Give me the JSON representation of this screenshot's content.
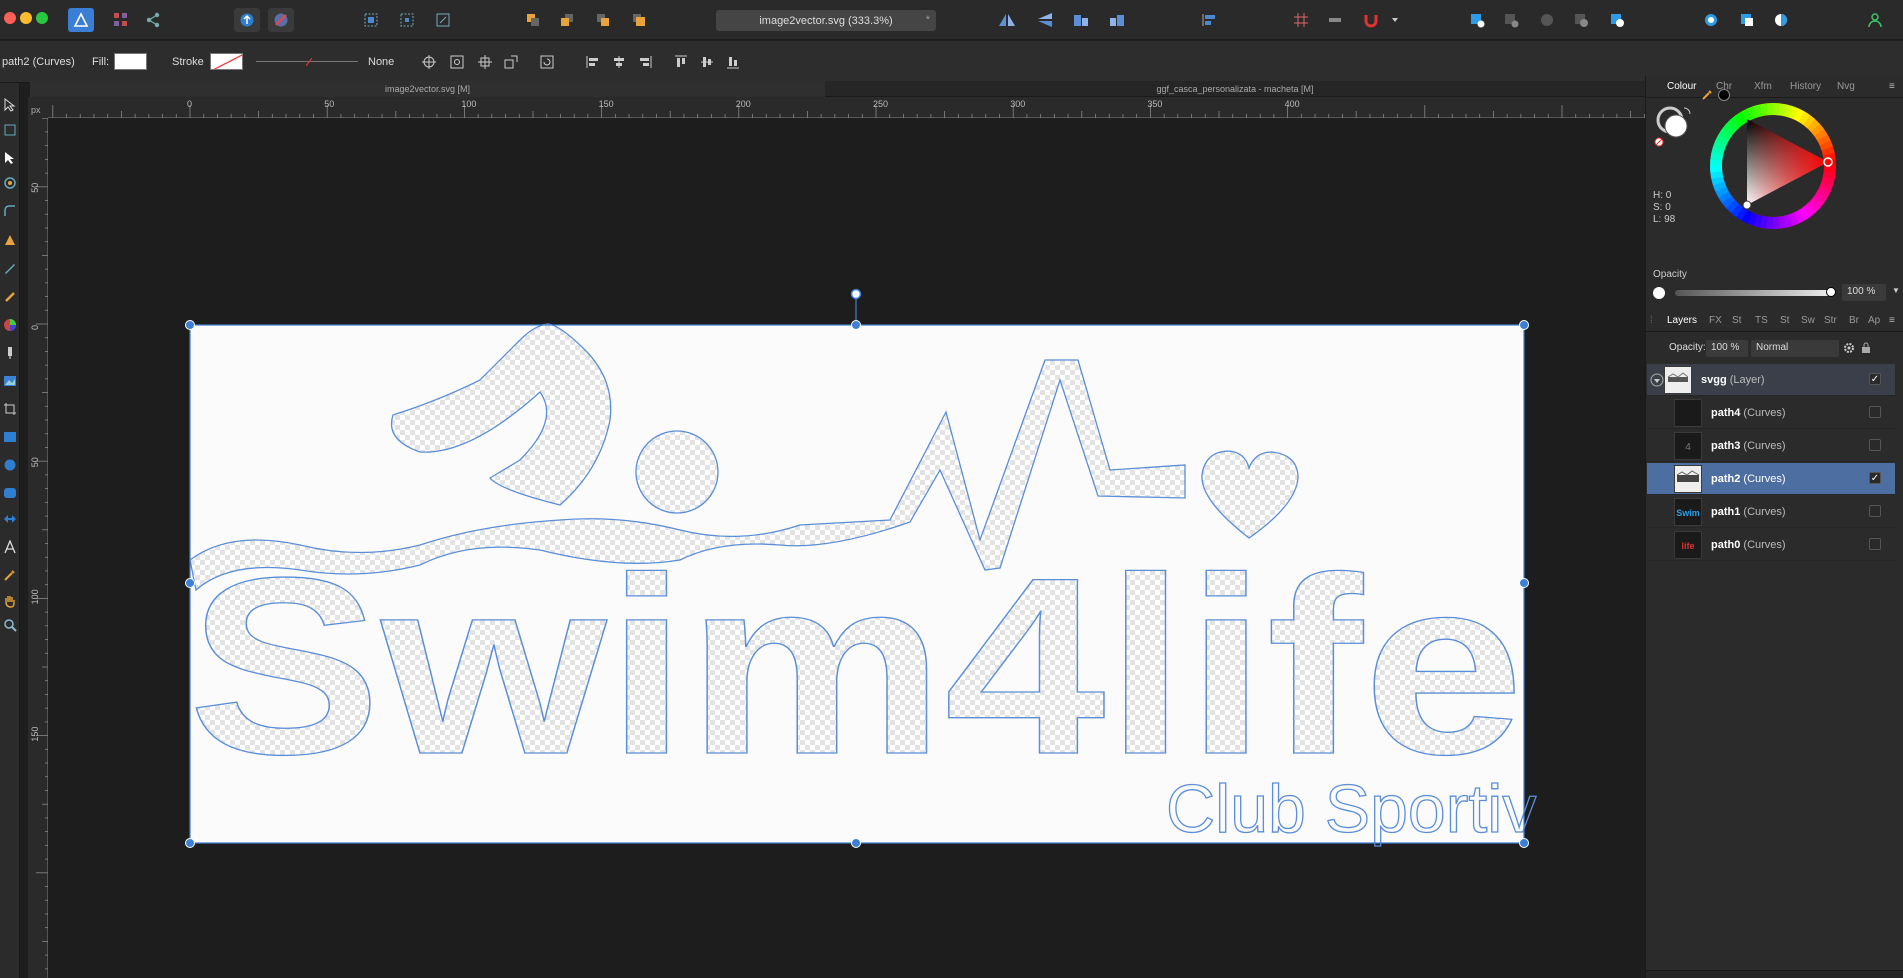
{
  "app": {
    "name": "Affinity Designer"
  },
  "toolbar": {
    "document_title": "image2vector.svg (333.3%)",
    "modified_marker": "*"
  },
  "context": {
    "selection": "path2 (Curves)",
    "fill_label": "Fill:",
    "stroke_label": "Stroke",
    "stroke_none": "None"
  },
  "doc_tabs": [
    "image2vector.svg [M]",
    "ggf_casca_personalizata - macheta [M]"
  ],
  "ruler": {
    "unit": "px",
    "h_ticks": [
      "0",
      "50",
      "100",
      "150",
      "200",
      "250",
      "300",
      "350",
      "400"
    ],
    "v_ticks": [
      "50",
      "0",
      "50",
      "100",
      "150"
    ]
  },
  "artwork": {
    "main_text": "Swim4life",
    "sub_text": "Club Sportiv"
  },
  "colour_panel": {
    "tabs": [
      "Colour",
      "Chr",
      "Xfm",
      "History",
      "Nvg"
    ],
    "active_tab": "Colour",
    "h": "H: 0",
    "s": "S: 0",
    "l": "L: 98",
    "opacity_label": "Opacity",
    "opacity_value": "100 %"
  },
  "layers_panel": {
    "tabs": [
      "Layers",
      "FX",
      "St",
      "TS",
      "St",
      "Sw",
      "Str",
      "Br",
      "Ap"
    ],
    "active_tab": "Layers",
    "opacity_label": "Opacity:",
    "opacity_value": "100 %",
    "blend_mode": "Normal",
    "layers": [
      {
        "name": "svgg",
        "kind": "(Layer)",
        "checked": true,
        "selected": false,
        "thumb_glyph": ""
      },
      {
        "name": "path4",
        "kind": "(Curves)",
        "checked": false,
        "selected": false,
        "thumb_glyph": ""
      },
      {
        "name": "path3",
        "kind": "(Curves)",
        "checked": false,
        "selected": false,
        "thumb_glyph": "4"
      },
      {
        "name": "path2",
        "kind": "(Curves)",
        "checked": true,
        "selected": true,
        "thumb_glyph": ""
      },
      {
        "name": "path1",
        "kind": "(Curves)",
        "checked": false,
        "selected": false,
        "thumb_glyph": "Swim"
      },
      {
        "name": "path0",
        "kind": "(Curves)",
        "checked": false,
        "selected": false,
        "thumb_glyph": "life"
      }
    ],
    "check_glyph": "✓"
  },
  "colors": {
    "selection_blue": "#3d7fd6",
    "artwork_outline": "#5a8ed8",
    "panel_selected": "#4d6ea0",
    "accent_orange": "#e8a33a",
    "accent_blue": "#2e9be6"
  }
}
